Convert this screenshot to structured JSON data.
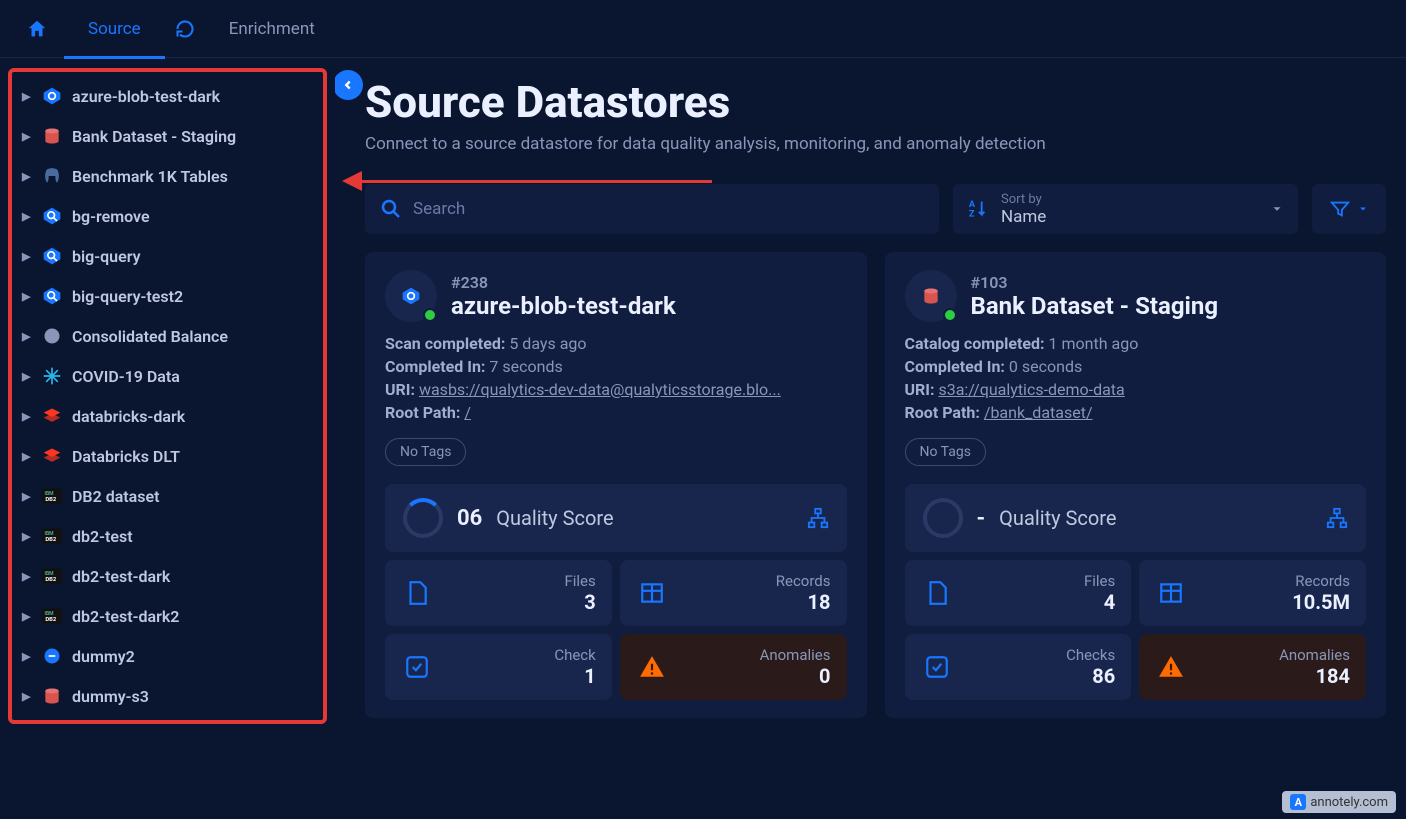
{
  "tabs": {
    "home": "home",
    "source": "Source",
    "enrichment": "Enrichment"
  },
  "sidebar": {
    "items": [
      {
        "label": "azure-blob-test-dark",
        "icon": "azure"
      },
      {
        "label": "Bank Dataset - Staging",
        "icon": "s3"
      },
      {
        "label": "Benchmark 1K Tables",
        "icon": "postgres"
      },
      {
        "label": "bg-remove",
        "icon": "bigquery"
      },
      {
        "label": "big-query",
        "icon": "bigquery"
      },
      {
        "label": "big-query-test2",
        "icon": "bigquery"
      },
      {
        "label": "Consolidated Balance",
        "icon": "generic"
      },
      {
        "label": "COVID-19 Data",
        "icon": "snowflake"
      },
      {
        "label": "databricks-dark",
        "icon": "databricks"
      },
      {
        "label": "Databricks DLT",
        "icon": "databricks"
      },
      {
        "label": "DB2 dataset",
        "icon": "db2"
      },
      {
        "label": "db2-test",
        "icon": "db2"
      },
      {
        "label": "db2-test-dark",
        "icon": "db2"
      },
      {
        "label": "db2-test-dark2",
        "icon": "db2"
      },
      {
        "label": "dummy2",
        "icon": "generic-blue"
      },
      {
        "label": "dummy-s3",
        "icon": "s3"
      }
    ]
  },
  "page": {
    "title": "Source Datastores",
    "subtitle": "Connect to a source datastore for data quality analysis, monitoring, and anomaly detection"
  },
  "toolbar": {
    "search_placeholder": "Search",
    "sort_label": "Sort by",
    "sort_value": "Name"
  },
  "cards": [
    {
      "id": "#238",
      "name": "azure-blob-test-dark",
      "icon": "azure",
      "status_label": "Scan completed:",
      "status_value": "5 days ago",
      "completed_label": "Completed In:",
      "completed_value": "7 seconds",
      "uri_label": "URI:",
      "uri_value": "wasbs://qualytics-dev-data@qualyticsstorage.blo...",
      "root_label": "Root Path:",
      "root_value": "/",
      "tag": "No Tags",
      "quality_score": "06",
      "quality_label": "Quality Score",
      "stats": {
        "files_label": "Files",
        "files_value": "3",
        "records_label": "Records",
        "records_value": "18",
        "check_label": "Check",
        "check_value": "1",
        "anom_label": "Anomalies",
        "anom_value": "0"
      }
    },
    {
      "id": "#103",
      "name": "Bank Dataset - Staging",
      "icon": "s3",
      "status_label": "Catalog completed:",
      "status_value": "1 month ago",
      "completed_label": "Completed In:",
      "completed_value": "0 seconds",
      "uri_label": "URI:",
      "uri_value": "s3a://qualytics-demo-data",
      "root_label": "Root Path:",
      "root_value": "/bank_dataset/",
      "tag": "No Tags",
      "quality_score": "-",
      "quality_label": "Quality Score",
      "stats": {
        "files_label": "Files",
        "files_value": "4",
        "records_label": "Records",
        "records_value": "10.5M",
        "check_label": "Checks",
        "check_value": "86",
        "anom_label": "Anomalies",
        "anom_value": "184"
      }
    }
  ],
  "annotely": "annotely.com"
}
